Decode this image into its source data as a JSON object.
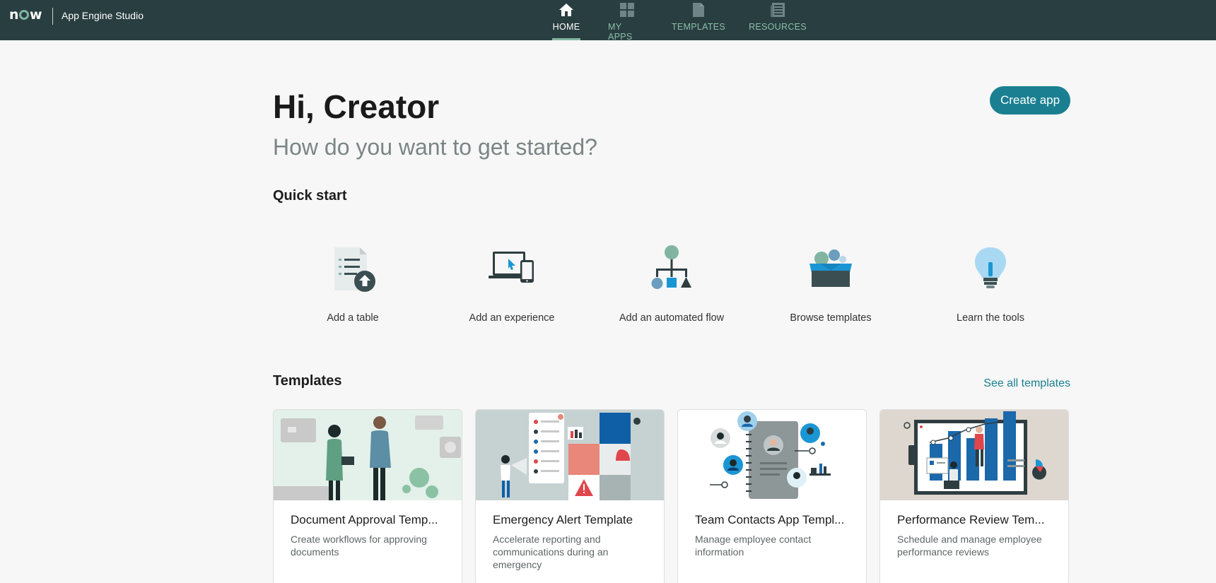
{
  "header": {
    "logo": "now",
    "app_name": "App Engine Studio",
    "nav": [
      {
        "label": "HOME",
        "icon": "home-icon",
        "active": true
      },
      {
        "label": "MY APPS",
        "icon": "grid-icon",
        "active": false
      },
      {
        "label": "TEMPLATES",
        "icon": "document-icon",
        "active": false
      },
      {
        "label": "RESOURCES",
        "icon": "newspaper-icon",
        "active": false
      }
    ]
  },
  "main": {
    "greeting": "Hi, Creator",
    "subtitle": "How do you want to get started?",
    "create_button": "Create app",
    "quick_start_title": "Quick start",
    "quick_start": [
      {
        "label": "Add a table",
        "icon": "table-upload-icon"
      },
      {
        "label": "Add an experience",
        "icon": "devices-icon"
      },
      {
        "label": "Add an automated flow",
        "icon": "flow-icon"
      },
      {
        "label": "Browse templates",
        "icon": "template-box-icon"
      },
      {
        "label": "Learn the tools",
        "icon": "lightbulb-icon"
      }
    ],
    "templates_title": "Templates",
    "see_all": "See all templates",
    "templates": [
      {
        "title": "Document Approval Temp...",
        "desc": "Create workflows for approving documents"
      },
      {
        "title": "Emergency Alert Template",
        "desc": "Accelerate reporting and communications during an emergency"
      },
      {
        "title": "Team Contacts App Templ...",
        "desc": "Manage employee contact information"
      },
      {
        "title": "Performance Review Tem...",
        "desc": "Schedule and manage employee performance reviews"
      }
    ]
  },
  "colors": {
    "header_bg": "#293e40",
    "accent": "#81b5a1",
    "primary": "#1a7f91"
  }
}
